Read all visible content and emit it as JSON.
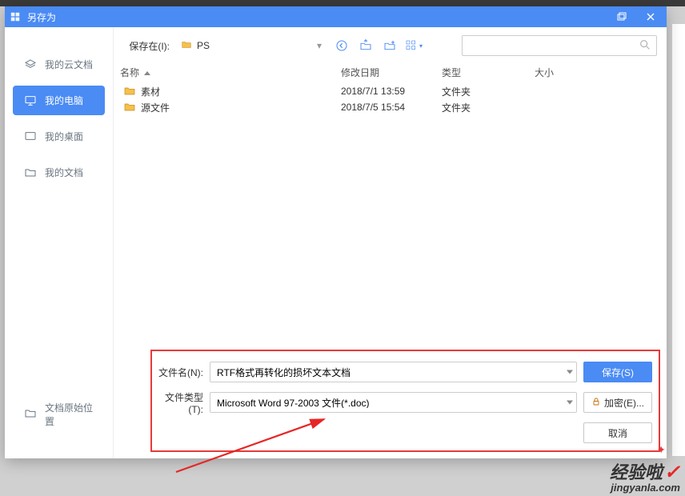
{
  "title": "另存为",
  "sidebar": {
    "items": [
      {
        "icon": "cloud",
        "label": "我的云文档"
      },
      {
        "icon": "pc",
        "label": "我的电脑"
      },
      {
        "icon": "desktop",
        "label": "我的桌面"
      },
      {
        "icon": "folder",
        "label": "我的文档"
      }
    ],
    "bottom": {
      "icon": "folder",
      "label": "文档原始位置"
    }
  },
  "toolbar": {
    "save_in_label": "保存在(I):",
    "current_folder": "PS"
  },
  "columns": {
    "name": "名称",
    "modified": "修改日期",
    "type": "类型",
    "size": "大小"
  },
  "rows": [
    {
      "name": "素材",
      "modified": "2018/7/1 13:59",
      "type": "文件夹",
      "size": ""
    },
    {
      "name": "源文件",
      "modified": "2018/7/5 15:54",
      "type": "文件夹",
      "size": ""
    }
  ],
  "form": {
    "filename_label": "文件名(N):",
    "filename_value": "RTF格式再转化的损坏文本文档",
    "filetype_label": "文件类型(T):",
    "filetype_value": "Microsoft Word 97-2003 文件(*.doc)",
    "save_btn": "保存(S)",
    "encrypt_btn": "加密(E)...",
    "cancel_btn": "取消"
  },
  "watermark": {
    "cn": "经验啦",
    "en": "jingyanla.com"
  }
}
